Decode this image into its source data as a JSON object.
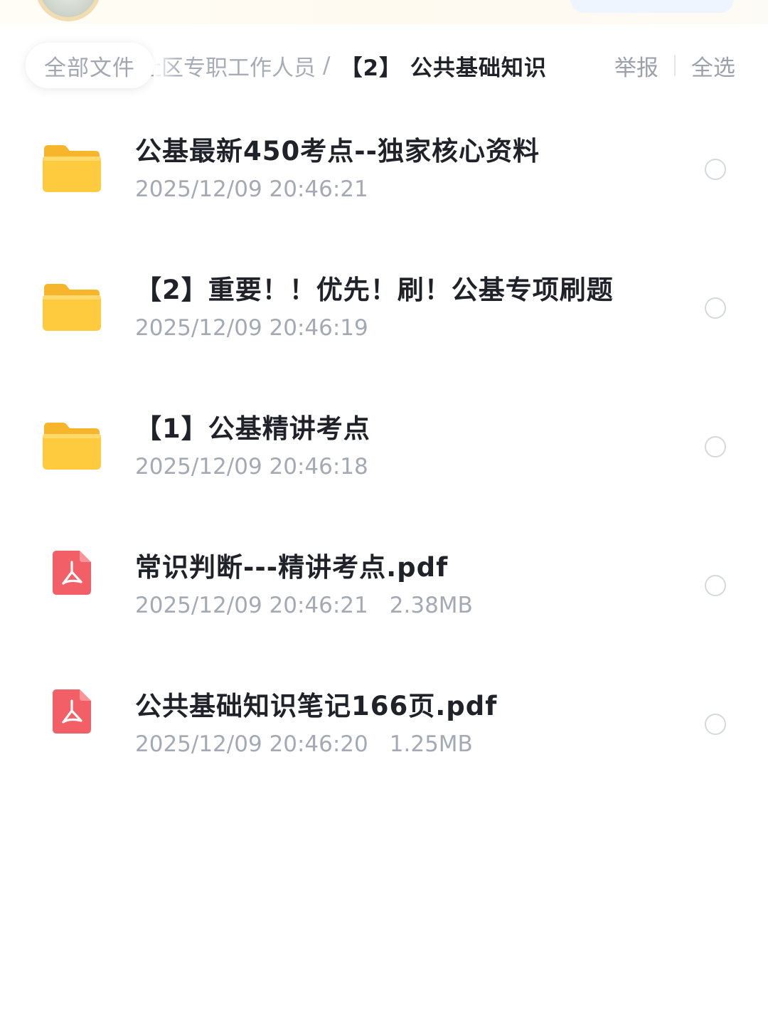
{
  "breadcrumb": {
    "root": "全部文件",
    "parent": "社区专职工作人员",
    "separator": "/",
    "current": "【2】 公共基础知识"
  },
  "actions": {
    "report": "举报",
    "select_all": "全选"
  },
  "files": [
    {
      "type": "folder",
      "name": "公基最新450考点--独家核心资料",
      "date": "2025/12/09 20:46:21",
      "size": ""
    },
    {
      "type": "folder",
      "name": "【2】重要！！优先！刷！公基专项刷题",
      "date": "2025/12/09 20:46:19",
      "size": ""
    },
    {
      "type": "folder",
      "name": "【1】公基精讲考点",
      "date": "2025/12/09 20:46:18",
      "size": ""
    },
    {
      "type": "pdf",
      "name": "常识判断---精讲考点.pdf",
      "date": "2025/12/09 20:46:21",
      "size": "2.38MB"
    },
    {
      "type": "pdf",
      "name": "公共基础知识笔记166页.pdf",
      "date": "2025/12/09 20:46:20",
      "size": "1.25MB"
    }
  ],
  "icons": {
    "folder": "folder-icon",
    "pdf": "pdf-file-icon",
    "select": "radio-circle-icon"
  },
  "colors": {
    "folder_yellow": "#ffc93a",
    "pdf_red": "#f25f67",
    "title_text": "#1f2329",
    "meta_text": "#a4aab3"
  }
}
